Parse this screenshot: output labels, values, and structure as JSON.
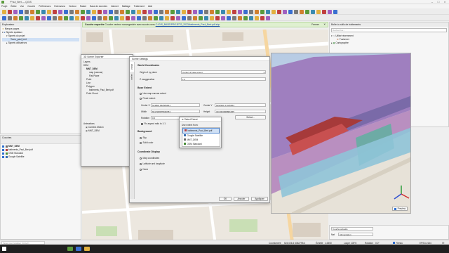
{
  "window": {
    "title": "*Paul_Bert — QGIS"
  },
  "menu": [
    "Projet",
    "Éditer",
    "Vue",
    "Couche",
    "Préférences",
    "Extensions",
    "Vecteur",
    "Raster",
    "Base de données",
    "Internet",
    "Maillage",
    "Traitement",
    "Aide"
  ],
  "explorer": {
    "title": "Explorateur",
    "items": [
      "Marque-pages",
      "Signets spatiaux",
      "Signets du projet",
      "Tours_paul_bert",
      "Signets utilisateurs"
    ]
  },
  "layers": {
    "title": "Couches",
    "items": [
      {
        "name": "MNT_DEM",
        "color": "#6a6a6a"
      },
      {
        "name": "batiments_Paul_Bert.pdf",
        "color": "#b84040"
      },
      {
        "name": "OSM Standard",
        "color": "#4a8f3a"
      },
      {
        "name": "Google Satellite",
        "color": "#3a6fb0"
      }
    ]
  },
  "message_bar": {
    "title": "Couche exportée",
    "text": "Couche vecteur sauvegardée avec succès vers",
    "link": "C:/GIS_BASE/PROJETS_2023/batiments_Paul_Bert.pdf.shp",
    "action": "Fermer"
  },
  "processing": {
    "title": "Boîte à outils de traitements",
    "search_placeholder": "Rechercher...",
    "items": [
      "Utilisé récemment",
      "Fusionner",
      "Cartographie"
    ]
  },
  "scene_export": {
    "title": "3D Scene Exporter",
    "layers_label": "Layers",
    "tree": [
      "DEM",
      "MNT_DEM",
      "map (canvas)",
      "Flat Plane",
      "Point",
      "Line",
      "Polygon",
      "batiments_Paul_Bert.pdf",
      "Point Cloud"
    ],
    "animations_label": "Animations",
    "animations": [
      "Camera Motion",
      "MNT_DEM"
    ]
  },
  "scene_settings": {
    "title": "Scene Settings",
    "side_tabs": [
      "World",
      "Layers"
    ],
    "world": {
      "heading": "World Coordinates",
      "origin_label": "Origin of xy plane",
      "origin_value": "Center of base extent",
      "zexag_label": "Z exaggeration",
      "zexag_value": "1.0"
    },
    "base_extent": {
      "heading": "Base Extent",
      "opt_canvas": "Use map canvas extent",
      "opt_fixed": "Fixed extent:",
      "center_x_label": "Center X",
      "center_x": "523806.932584961",
      "center_y_label": "Center Y",
      "center_y": "6352931.27045063",
      "width_label": "Width",
      "width": "661.508975639784",
      "height_label": "Height",
      "height": "316.903848881255",
      "rotation_label": "Rotation",
      "rotation": "0.0",
      "select_btn": "Select...",
      "aspect": "Fix aspect ratio to 1:1"
    },
    "background": {
      "heading": "Background",
      "opt_sky": "Sky",
      "opt_solid": "Solid color"
    },
    "coord_display": {
      "heading": "Coordinate Display",
      "opt_map": "Map coordinates",
      "opt_latlon": "Latitude and longitude",
      "opt_none": "None"
    },
    "buttons": {
      "ok": "OK",
      "cancel": "Annuler",
      "apply": "Appliquer"
    }
  },
  "select_extent": {
    "title": "Select Extent",
    "label": "Use extent from:",
    "items": [
      "batiments_Paul_Bert.pdf",
      "Google Satellite",
      "MNT_DEM",
      "OSM Standard"
    ],
    "selected": 0
  },
  "right_lower": {
    "layer_style_label": "Couche actuelle",
    "nat_label": "Nat",
    "nat_value": "Alimentation"
  },
  "preview_label": "Preview",
  "status": {
    "search_placeholder": "Taper pour localiser (Ctrl+K)",
    "coord_label": "Coordonnée",
    "coord_value": "524,026.4 6352795.4",
    "scale_label": "Échelle",
    "scale_value": "1:2550",
    "magnifier_label": "Loupe",
    "magnifier_value": "100%",
    "rotation_label": "Rotation",
    "rotation_value": "0.0°",
    "render_label": "Rendu",
    "crs": "EPSG:2154"
  }
}
